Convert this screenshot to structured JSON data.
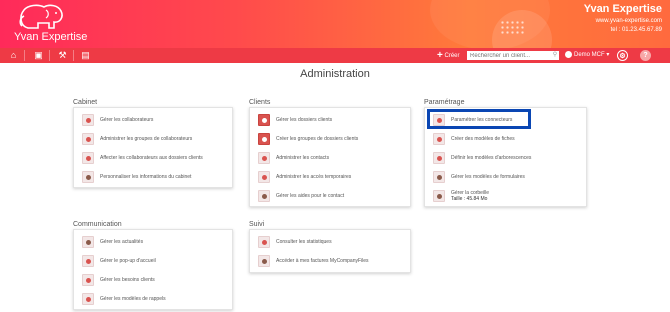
{
  "header": {
    "logo_text": "Yvan Expertise",
    "brand_name": "Yvan Expertise",
    "website": "www.yvan-expertise.com",
    "phone": "tel : 01.23.45.67.89",
    "colors": {
      "gradient_start": "#ff2a5a",
      "gradient_end": "#ff6a3e"
    }
  },
  "toolbar": {
    "icons": [
      "home-icon",
      "folder-icon",
      "tools-icon",
      "clipboard-icon"
    ],
    "create_label": "Créer",
    "search_placeholder": "Rechercher un client...",
    "user_label": "Demo MCF",
    "settings_icon": "gear-icon",
    "help_label": "?"
  },
  "page_title": "Administration",
  "sections": {
    "cabinet": {
      "title": "Cabinet",
      "items": [
        "Gérer les collaborateurs",
        "Administrer les groupes de collaborateurs",
        "Affecter les collaborateurs aux dossiers clients",
        "Personnaliser les informations du cabinet"
      ]
    },
    "clients": {
      "title": "Clients",
      "items": [
        "Gérer les dossiers clients",
        "Créer les groupes de dossiers clients",
        "Administrer les contacts",
        "Administrer les accès temporaires",
        "Gérer les aides pour le contact"
      ]
    },
    "parametrage": {
      "title": "Paramétrage",
      "items": [
        "Paramétrer les connecteurs",
        "Créer des modèles de fiches",
        "Définir les modèles d'arborescences",
        "Gérer les modèles de formulaires",
        "Gérer la corbeille"
      ],
      "corbeille_size": "Taille : 45.84 Mo"
    },
    "communication": {
      "title": "Communication",
      "items": [
        "Gérer les actualités",
        "Gérer le pop-up d'accueil",
        "Gérer les besoins clients",
        "Gérer les modèles de rappels"
      ]
    },
    "suivi": {
      "title": "Suivi",
      "items": [
        "Consulter les statistiques",
        "Accéder à mes factures MyCompanyFiles"
      ]
    }
  }
}
